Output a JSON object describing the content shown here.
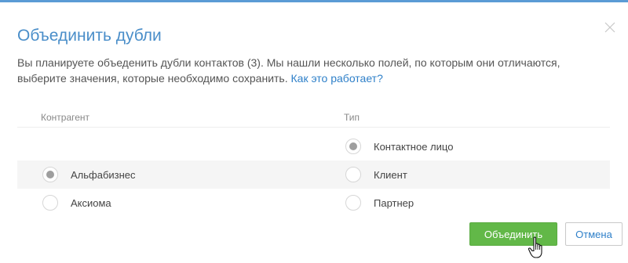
{
  "dialog": {
    "title": "Объединить дубли",
    "description": "Вы планируете объеденить дубли контактов (3). Мы нашли несколько полей, по которым они отличаются, выберите значения, которые необходимо сохранить.",
    "help_link": "Как это работает?",
    "close_icon": "close-icon"
  },
  "columns": {
    "col1_header": "Контрагент",
    "col2_header": "Тип"
  },
  "rows": [
    {
      "col1": null,
      "col2": {
        "label": "Контактное лицо",
        "selected": true
      }
    },
    {
      "col1": {
        "label": "Альфабизнес",
        "selected": true
      },
      "col2": {
        "label": "Клиент",
        "selected": false
      }
    },
    {
      "col1": {
        "label": "Аксиома",
        "selected": false
      },
      "col2": {
        "label": "Партнер",
        "selected": false
      }
    }
  ],
  "buttons": {
    "merge_label": "Объединить",
    "cancel_label": "Отмена"
  },
  "colors": {
    "accent": "#4a8ec9",
    "link": "#2f80c9",
    "primary_button": "#62b848"
  }
}
